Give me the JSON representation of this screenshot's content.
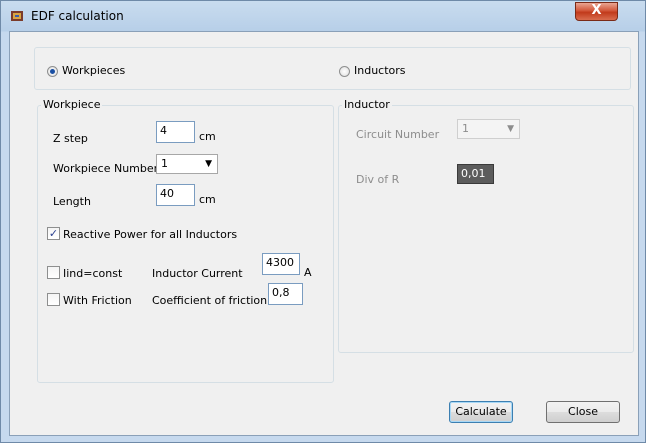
{
  "window": {
    "title": "EDF calculation",
    "close_label": "X"
  },
  "mode": {
    "options": [
      "Workpieces",
      "Inductors"
    ],
    "selected": "Workpieces"
  },
  "workpiece": {
    "group_label": "Workpiece",
    "z_step": {
      "label": "Z step",
      "value": "4",
      "unit": "cm"
    },
    "workpiece_number": {
      "label": "Workpiece Number",
      "value": "1"
    },
    "length": {
      "label": "Length",
      "value": "40",
      "unit": "cm"
    },
    "reactive_power": {
      "label": "Reactive Power for all Inductors",
      "checked": true
    },
    "iind_const": {
      "label": "Iind=const",
      "checked": false
    },
    "inductor_current": {
      "label": "Inductor Current",
      "value": "4300",
      "unit": "A"
    },
    "with_friction": {
      "label": "With Friction",
      "checked": false
    },
    "coefficient_of_friction": {
      "label": "Coefficient of friction",
      "value": "0,8"
    }
  },
  "inductor": {
    "group_label": "Inductor",
    "circuit_number": {
      "label": "Circuit Number",
      "value": "1"
    },
    "div_of_r": {
      "label": "Div of R",
      "value": "0,01"
    }
  },
  "buttons": {
    "calculate": "Calculate",
    "close": "Close"
  },
  "colors": {
    "title_bar": "#b7cfe8",
    "close_button": "#c13a1b",
    "client_background": "#f0f0f0"
  }
}
